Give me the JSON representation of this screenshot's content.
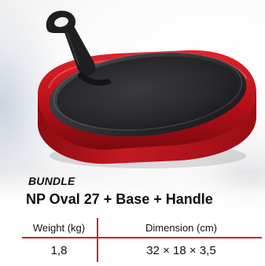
{
  "colors": {
    "accent": "#d0202a",
    "base_red": "#c0141c",
    "iron": "#2a2a2d"
  },
  "image": {
    "icon": "cast-iron-sizzler-plate-image"
  },
  "product": {
    "bundle_label": "BUNDLE",
    "name": "NP Oval 27 + Base + Handle"
  },
  "specs": {
    "weight_header": "Weight (kg)",
    "dimension_header": "Dimension (cm)",
    "weight_value": "1,8",
    "dimension_value": "32 × 18 × 3,5"
  }
}
